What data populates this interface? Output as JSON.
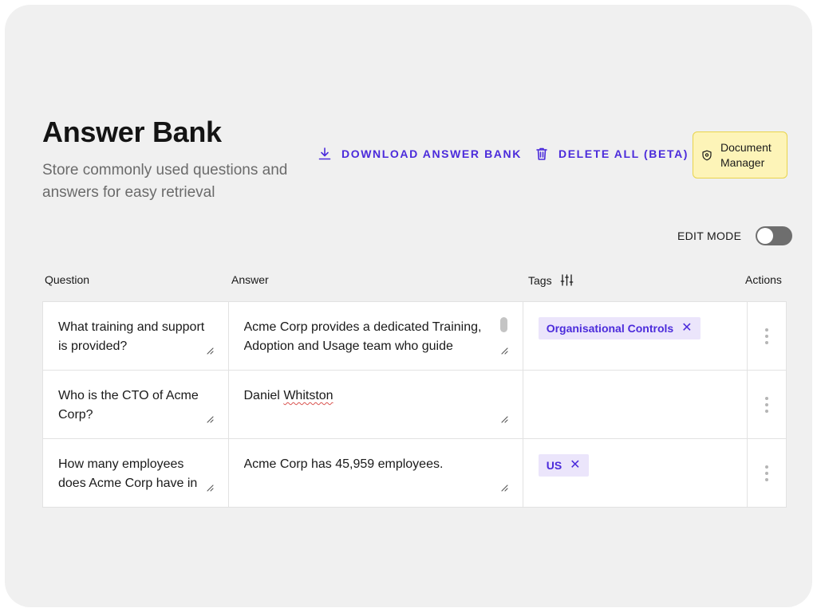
{
  "header": {
    "title": "Answer Bank",
    "subtitle": "Store commonly used questions and answers for easy retrieval"
  },
  "actions": {
    "download_label": "DOWNLOAD ANSWER BANK",
    "delete_label": "DELETE ALL (BETA)",
    "document_manager_label": "Document Manager"
  },
  "edit_mode": {
    "label": "EDIT MODE",
    "enabled": false
  },
  "columns": {
    "question": "Question",
    "answer": "Answer",
    "tags": "Tags",
    "actions": "Actions"
  },
  "rows": [
    {
      "question": "What training and support is provided?",
      "answer": "Acme Corp provides a dedicated Training, Adoption and Usage team who guide",
      "tags": [
        "Organisational Controls"
      ]
    },
    {
      "question": "Who is the CTO of Acme Corp?",
      "answer_first": "Daniel",
      "answer_flagged": "Whitston",
      "tags": []
    },
    {
      "question": "How many employees does Acme Corp have in",
      "answer": "Acme Corp has 45,959 employees.",
      "tags": [
        "US"
      ]
    }
  ],
  "colors": {
    "accent": "#4b2bdb",
    "tag_background": "#ebe5fb",
    "doc_manager_background": "#fdf4b8",
    "doc_manager_border": "#e8d44c",
    "panel_background": "#f0f0f0"
  },
  "icons": {
    "download": "download-icon",
    "delete": "trash-icon",
    "document_manager": "shield-icon",
    "tags_filter": "sliders-icon",
    "row_menu": "kebab-menu-icon",
    "tag_remove": "close-icon",
    "resize": "resize-handle-icon"
  }
}
